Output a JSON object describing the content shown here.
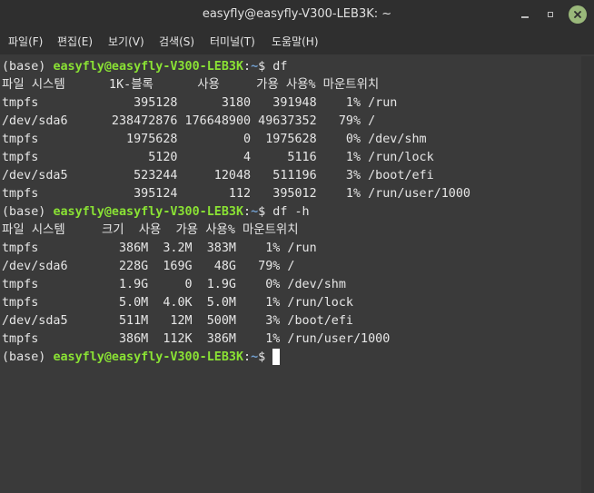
{
  "window": {
    "title": "easyfly@easyfly-V300-LEB3K: ~"
  },
  "menu": [
    {
      "label": "파일(F)"
    },
    {
      "label": "편집(E)"
    },
    {
      "label": "보기(V)"
    },
    {
      "label": "검색(S)"
    },
    {
      "label": "터미널(T)"
    },
    {
      "label": "도움말(H)"
    }
  ],
  "terminal": {
    "prompt_prefix": "(base) ",
    "prompt_user": "easyfly@easyfly-V300-LEB3K",
    "prompt_sep": ":",
    "prompt_path": "~",
    "prompt_end": "$ ",
    "cmd1": "df",
    "cmd2": "df -h",
    "df_header": "파일 시스템      1K-블록      사용     가용 사용% 마운트위치",
    "df_rows": [
      "tmpfs             395128      3180   391948    1% /run",
      "/dev/sda6      238472876 176648900 49637352   79% /",
      "tmpfs            1975628         0  1975628    0% /dev/shm",
      "tmpfs               5120         4     5116    1% /run/lock",
      "/dev/sda5         523244     12048   511196    3% /boot/efi",
      "tmpfs             395124       112   395012    1% /run/user/1000"
    ],
    "dfh_header": "파일 시스템     크기  사용  가용 사용% 마운트위치",
    "dfh_rows": [
      "tmpfs           386M  3.2M  383M    1% /run",
      "/dev/sda6       228G  169G   48G   79% /",
      "tmpfs           1.9G     0  1.9G    0% /dev/shm",
      "tmpfs           5.0M  4.0K  5.0M    1% /run/lock",
      "/dev/sda5       511M   12M  500M    3% /boot/efi",
      "tmpfs           386M  112K  386M    1% /run/user/1000"
    ]
  }
}
